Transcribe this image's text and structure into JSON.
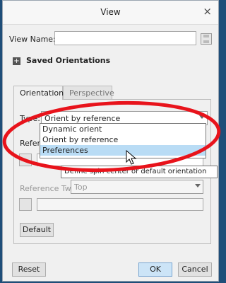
{
  "dialog": {
    "title": "View",
    "close_glyph": "×",
    "view_name_label": "View Name:",
    "view_name_value": "",
    "saved_orientations_label": "Saved Orientations"
  },
  "tabs": [
    {
      "label": "Orientation",
      "active": true
    },
    {
      "label": "Perspective",
      "active": false
    }
  ],
  "orientation": {
    "type_label": "Type:",
    "type_selected": "Orient by reference",
    "type_options": [
      "Dynamic orient",
      "Orient by reference",
      "Preferences"
    ],
    "highlighted_option": "Preferences",
    "reference_one_label": "Refere",
    "tooltip": "Define spin center or default orientation",
    "reference_two_label": "Reference Two:",
    "reference_two_value": "Top",
    "default_button": "Default"
  },
  "footer": {
    "reset_button": "Reset",
    "ok_button": "OK",
    "cancel_button": "Cancel"
  },
  "colors": {
    "accent": "#cce4f7",
    "highlight": "#b9dcf5",
    "annotation": "#e8131b"
  },
  "icons": [
    "close-icon",
    "save-icon",
    "expand-plus-icon",
    "arrow-pointer-icon",
    "mouse-cursor-icon",
    "dropdown-arrow-icon"
  ]
}
